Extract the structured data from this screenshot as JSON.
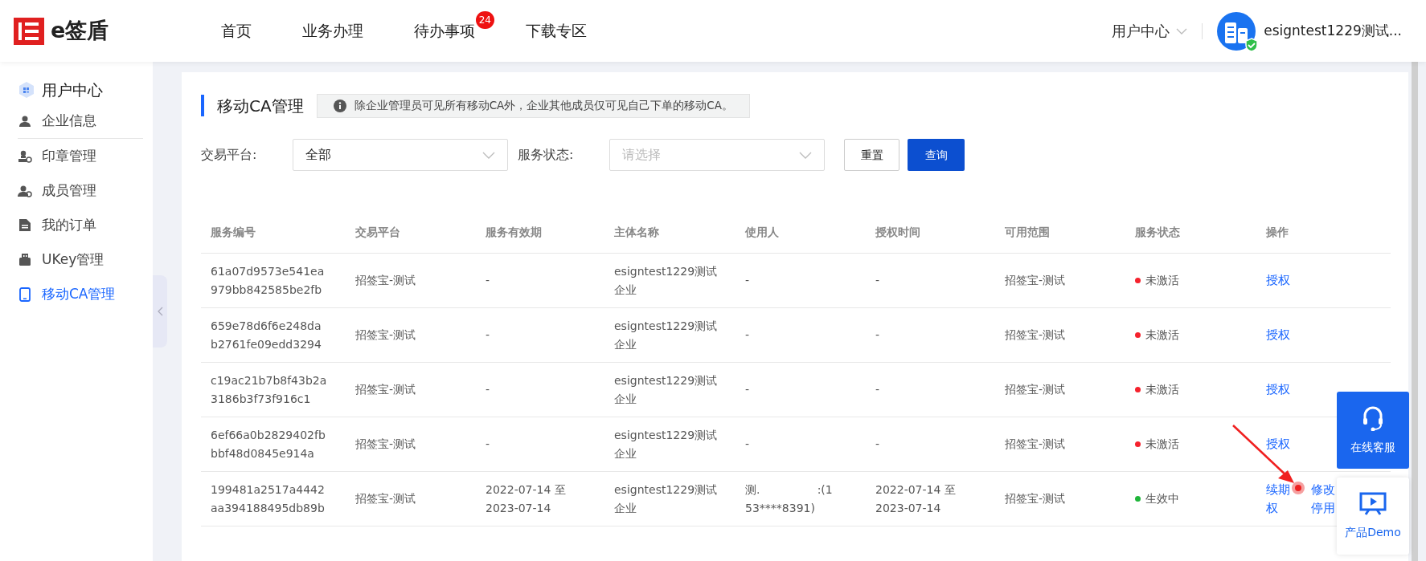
{
  "logo": {
    "name": "e签盾"
  },
  "nav": [
    {
      "label": "首页",
      "selected": false
    },
    {
      "label": "业务办理",
      "selected": false
    },
    {
      "label": "待办事项",
      "selected": false,
      "badge": "24"
    },
    {
      "label": "下载专区",
      "selected": false
    }
  ],
  "user_menu": {
    "label": "用户中心"
  },
  "account": {
    "name": "esigntest1229测试...",
    "verified": true
  },
  "sidebar": {
    "title": "用户中心",
    "items": [
      {
        "label": "企业信息",
        "kind": "person",
        "selected": false
      },
      {
        "label": "印章管理",
        "kind": "seal",
        "selected": false
      },
      {
        "label": "成员管理",
        "kind": "member",
        "selected": false
      },
      {
        "label": "我的订单",
        "kind": "order",
        "selected": false
      },
      {
        "label": "UKey管理",
        "kind": "ukey",
        "selected": false
      },
      {
        "label": "移动CA管理",
        "kind": "phone",
        "selected": true
      }
    ]
  },
  "page": {
    "title": "移动CA管理",
    "notice": "除企业管理员可见所有移动CA外，企业其他成员仅可见自己下单的移动CA。"
  },
  "filters": [
    {
      "label": "交易平台:",
      "value": "全部"
    },
    {
      "label": "服务状态:",
      "placeholder": "请选择"
    }
  ],
  "buttons": {
    "reset": "重置",
    "query": "查询"
  },
  "table": {
    "columns": [
      "服务编号",
      "交易平台",
      "服务有效期",
      "主体名称",
      "使用人",
      "授权时间",
      "可用范围",
      "服务状态",
      "操作"
    ],
    "rows": [
      {
        "id": [
          "61a07d9573e541ea",
          "979bb842585be2fb"
        ],
        "platform": [
          "招签宝-测试"
        ],
        "validity": [
          "-"
        ],
        "subject": [
          "esigntest1229测试",
          "企业"
        ],
        "user": [
          "-"
        ],
        "auth_time": [
          "-"
        ],
        "scope": [
          "招签宝-测试"
        ],
        "status": {
          "label": "未激活",
          "color": "#f5222d"
        },
        "actions": [
          "授权"
        ]
      },
      {
        "id": [
          "659e78d6f6e248da",
          "b2761fe09edd3294"
        ],
        "platform": [
          "招签宝-测试"
        ],
        "validity": [
          "-"
        ],
        "subject": [
          "esigntest1229测试",
          "企业"
        ],
        "user": [
          "-"
        ],
        "auth_time": [
          "-"
        ],
        "scope": [
          "招签宝-测试"
        ],
        "status": {
          "label": "未激活",
          "color": "#f5222d"
        },
        "actions": [
          "授权"
        ]
      },
      {
        "id": [
          "c19ac21b7b8f43b2a",
          "3186b3f73f916c1"
        ],
        "platform": [
          "招签宝-测试"
        ],
        "validity": [
          "-"
        ],
        "subject": [
          "esigntest1229测试",
          "企业"
        ],
        "user": [
          "-"
        ],
        "auth_time": [
          "-"
        ],
        "scope": [
          "招签宝-测试"
        ],
        "status": {
          "label": "未激活",
          "color": "#f5222d"
        },
        "actions": [
          "授权"
        ]
      },
      {
        "id": [
          "6ef66a0b2829402fb",
          "bbf48d0845e914a"
        ],
        "platform": [
          "招签宝-测试"
        ],
        "validity": [
          "-"
        ],
        "subject": [
          "esigntest1229测试",
          "企业"
        ],
        "user": [
          "-"
        ],
        "auth_time": [
          "-"
        ],
        "scope": [
          "招签宝-测试"
        ],
        "status": {
          "label": "未激活",
          "color": "#f5222d"
        },
        "actions": [
          "授权"
        ]
      },
      {
        "id": [
          "199481a2517a4442",
          "aa394188495db89b"
        ],
        "platform": [
          "招签宝-测试"
        ],
        "validity": [
          "2022-07-14 至",
          "2023-07-14"
        ],
        "subject": [
          "esigntest1229测试",
          "企业"
        ],
        "user": [
          "测.                :(1",
          "53****8391)"
        ],
        "auth_time": [
          "2022-07-14 至",
          "2023-07-14"
        ],
        "scope": [
          "招签宝-测试"
        ],
        "status": {
          "label": "生效中",
          "color": "#1fb53a"
        },
        "actions": [
          "续期",
          "修改",
          "权",
          "停用"
        ]
      }
    ]
  },
  "widgets": {
    "service": "在线客服",
    "demo": "产品Demo"
  }
}
